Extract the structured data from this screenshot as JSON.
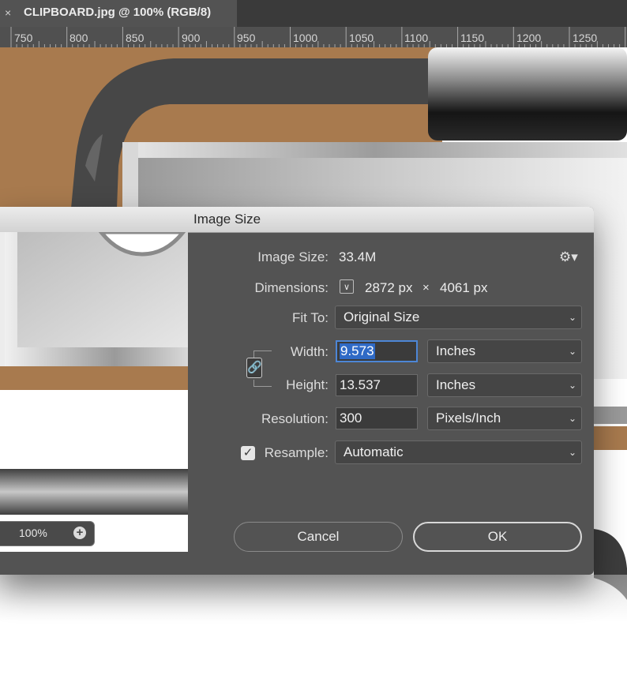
{
  "document_tab": {
    "close_glyph": "×",
    "title": "CLIPBOARD.jpg @ 100% (RGB/8)"
  },
  "ruler": {
    "labels": [
      "750",
      "800",
      "850",
      "900",
      "950",
      "1000",
      "1050",
      "1100",
      "1150",
      "1200",
      "1250"
    ]
  },
  "dialog": {
    "title": "Image Size",
    "image_size": {
      "label": "Image Size:",
      "value": "33.4M"
    },
    "settings_icon": "gear-icon",
    "dimensions": {
      "label": "Dimensions:",
      "width": "2872 px",
      "times": "×",
      "height": "4061 px",
      "menu_icon": "chevron-down-icon"
    },
    "fit_to": {
      "label": "Fit To:",
      "value": "Original Size"
    },
    "width": {
      "label": "Width:",
      "value": "9.573",
      "unit": "Inches"
    },
    "height": {
      "label": "Height:",
      "value": "13.537",
      "unit": "Inches"
    },
    "constrain_icon": "link-icon",
    "resolution": {
      "label": "Resolution:",
      "value": "300",
      "unit": "Pixels/Inch"
    },
    "resample": {
      "label": "Resample:",
      "checked": true,
      "value": "Automatic"
    },
    "preview": {
      "zoom": "100%"
    },
    "buttons": {
      "cancel": "Cancel",
      "ok": "OK"
    }
  },
  "colors": {
    "dialog_bg": "#535353",
    "canvas_brown": "#a87a4e",
    "pipe_dark": "#474747",
    "focus_blue": "#4d86d6"
  }
}
